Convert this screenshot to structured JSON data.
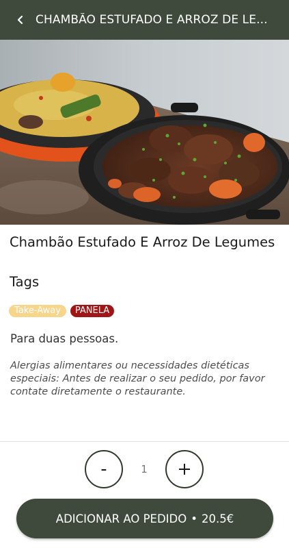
{
  "header": {
    "title": "CHAMBÃO ESTUFADO E ARROZ DE LE...",
    "back_icon": "chevron-left-icon"
  },
  "product": {
    "name": "Chambão Estufado E Arroz De Legumes",
    "tags_heading": "Tags",
    "tags": [
      {
        "label": "Take-Away",
        "color": "#f7d58a"
      },
      {
        "label": "PANELA",
        "color": "#a01616"
      }
    ],
    "description": "Para duas pessoas.",
    "allergy_notice": "Alergias alimentares ou necessidades dietéticas especiais: Antes de realizar o seu pedido, por favor contate diretamente o restaurante."
  },
  "quantity": {
    "decrement_label": "-",
    "value": "1",
    "increment_icon": "plus-icon"
  },
  "footer": {
    "add_label": "ADICIONAR AO PEDIDO",
    "separator": "•",
    "price": "20.5€"
  },
  "colors": {
    "primary": "#3f4a3c",
    "tag_takeaway": "#f7d58a",
    "tag_panela": "#a01616"
  }
}
